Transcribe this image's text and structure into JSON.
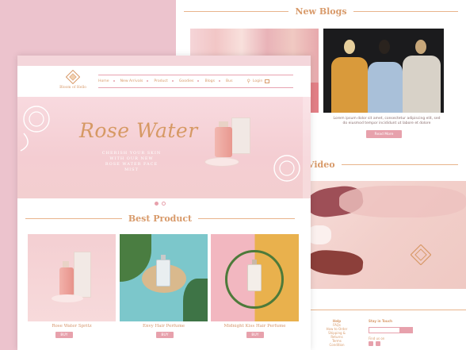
{
  "blog": {
    "title": "New Blogs",
    "text": "Lorem ipsum dolor sit amet, consectetur adipiscing elit, sed do eiusmod tempor incididunt ut labore et dolore",
    "read_more": "Read More"
  },
  "video": {
    "title": "Video"
  },
  "footer": {
    "help_title": "Help",
    "help_links": [
      "FAQs",
      "How to Order",
      "Shipping & Returns",
      "Terms Condition"
    ],
    "stay_title": "Stay in Touch",
    "follow_title": "Find us on"
  },
  "brand": {
    "name": "Bloom of Hello"
  },
  "nav": {
    "items": [
      "Home",
      "New Arrivals",
      "Product",
      "Goodies",
      "Blogs",
      "Bus"
    ],
    "login": "Login"
  },
  "hero": {
    "title": "Rose Water",
    "sub_lines": [
      "CHERISH YOUR SKIN",
      "WITH OUR NEW",
      "ROSE WATER FACE MIST"
    ]
  },
  "best_product": {
    "title": "Best Product",
    "items": [
      {
        "name": "Rose Water Spritz",
        "buy": "BUY"
      },
      {
        "name": "Envy Hair Perfume",
        "buy": "BUY"
      },
      {
        "name": "Midnight Kiss Hair Perfume",
        "buy": "BUY"
      }
    ]
  },
  "colors": {
    "accent": "#e7a1ac",
    "gold": "#d89a6a",
    "background": "#ecc3cd"
  }
}
